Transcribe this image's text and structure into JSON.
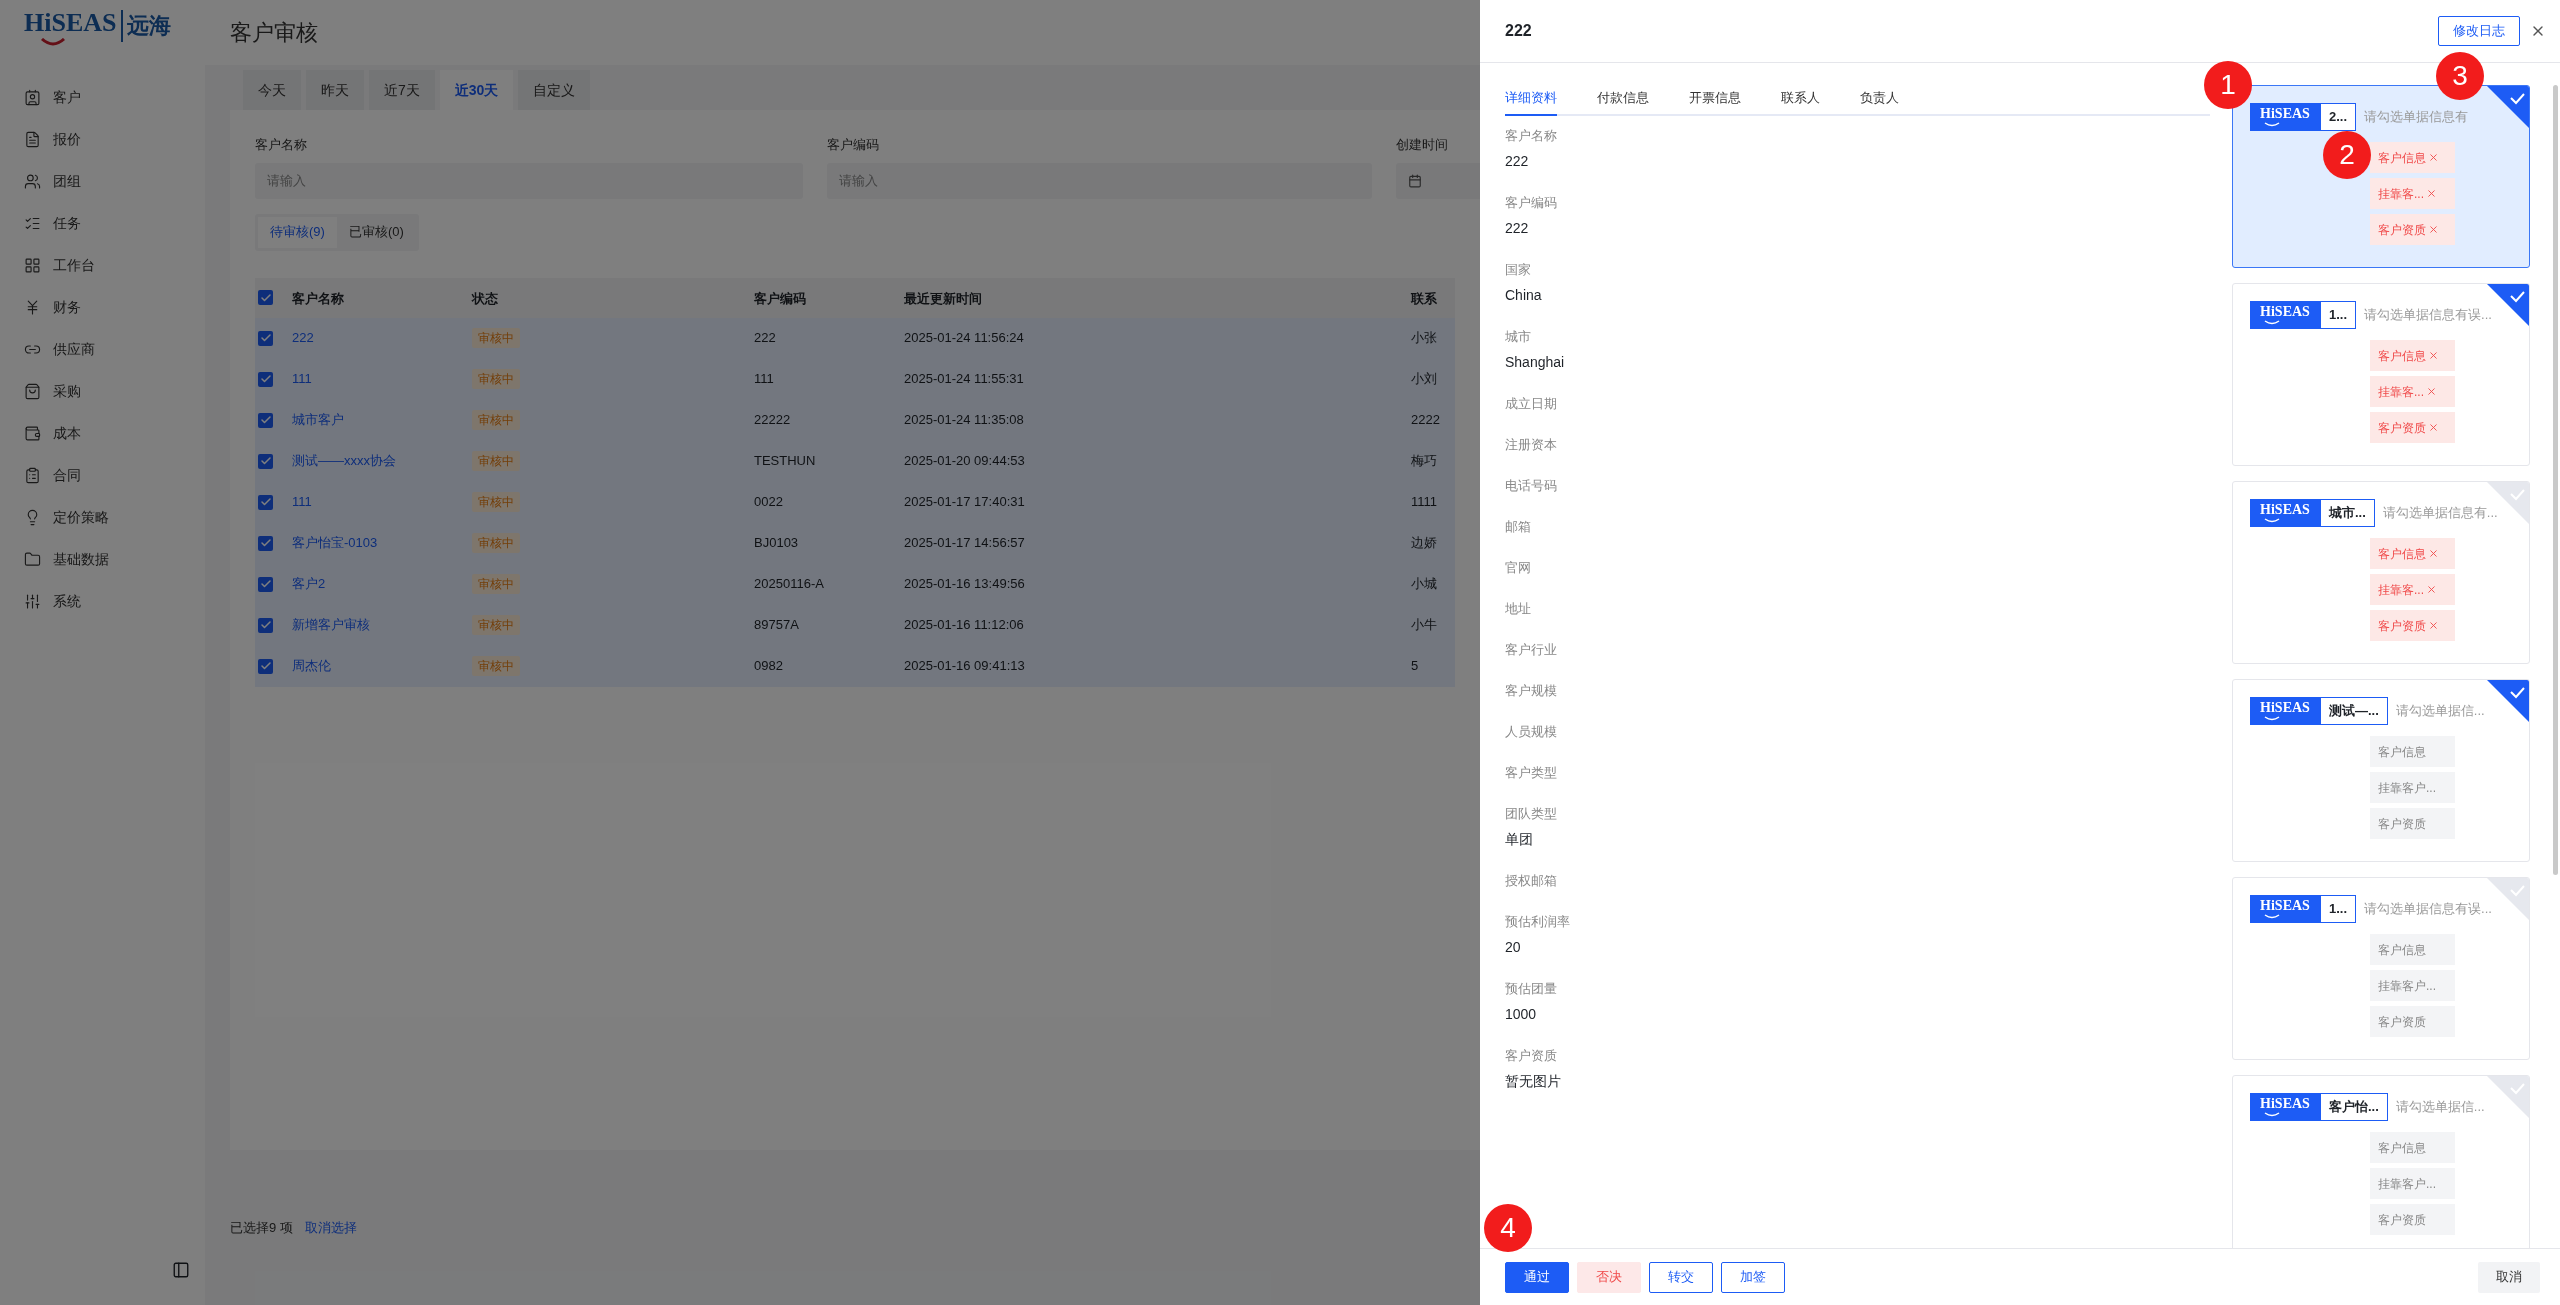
{
  "sidebar": {
    "logo": "HiSEAS",
    "logo_sub": "远海",
    "items": [
      {
        "label": "客户"
      },
      {
        "label": "报价"
      },
      {
        "label": "团组"
      },
      {
        "label": "任务"
      },
      {
        "label": "工作台"
      },
      {
        "label": "财务"
      },
      {
        "label": "供应商"
      },
      {
        "label": "采购"
      },
      {
        "label": "成本"
      },
      {
        "label": "合同"
      },
      {
        "label": "定价策略"
      },
      {
        "label": "基础数据"
      },
      {
        "label": "系统"
      }
    ]
  },
  "header": {
    "title": "客户审核"
  },
  "date_tabs": [
    {
      "label": "今天",
      "selected": false
    },
    {
      "label": "昨天",
      "selected": false
    },
    {
      "label": "近7天",
      "selected": false
    },
    {
      "label": "近30天",
      "selected": true
    },
    {
      "label": "自定义",
      "selected": false
    }
  ],
  "filters": [
    {
      "label": "客户名称",
      "kind": "text",
      "placeholder": "请输入"
    },
    {
      "label": "客户编码",
      "kind": "text",
      "placeholder": "请输入"
    },
    {
      "label": "创建时间",
      "kind": "date"
    }
  ],
  "status_tabs": [
    {
      "label": "待审核(9)",
      "selected": true
    },
    {
      "label": "已审核(0)",
      "selected": false
    }
  ],
  "table": {
    "all_checked": true,
    "columns": [
      "客户名称",
      "状态",
      "客户编码",
      "最近更新时间",
      "联系"
    ],
    "rows": [
      {
        "checked": true,
        "name": "222",
        "status": "审核中",
        "code": "222",
        "updated": "2025-01-24 11:56:24",
        "contact": "小张"
      },
      {
        "checked": true,
        "name": "111",
        "status": "审核中",
        "code": "111",
        "updated": "2025-01-24 11:55:31",
        "contact": "小刘"
      },
      {
        "checked": true,
        "name": "城市客户",
        "status": "审核中",
        "code": "22222",
        "updated": "2025-01-24 11:35:08",
        "contact": "2222"
      },
      {
        "checked": true,
        "name": "测试——xxxx协会",
        "status": "审核中",
        "code": "TESTHUN",
        "updated": "2025-01-20 09:44:53",
        "contact": "梅巧"
      },
      {
        "checked": true,
        "name": "111",
        "status": "审核中",
        "code": "0022",
        "updated": "2025-01-17 17:40:31",
        "contact": "1111"
      },
      {
        "checked": true,
        "name": "客户怡宝-0103",
        "status": "审核中",
        "code": "BJ0103",
        "updated": "2025-01-17 14:56:57",
        "contact": "边娇"
      },
      {
        "checked": true,
        "name": "客户2",
        "status": "审核中",
        "code": "20250116-A",
        "updated": "2025-01-16 13:49:56",
        "contact": "小城"
      },
      {
        "checked": true,
        "name": "新增客户审核",
        "status": "审核中",
        "code": "89757A",
        "updated": "2025-01-16 11:12:06",
        "contact": "小牛"
      },
      {
        "checked": true,
        "name": "周杰伦",
        "status": "审核中",
        "code": "0982",
        "updated": "2025-01-16 09:41:13",
        "contact": "5"
      }
    ]
  },
  "selection_bar": {
    "text": "已选择9 项",
    "clear": "取消选择"
  },
  "drawer": {
    "title": "222",
    "log_button": "修改日志",
    "tabs": [
      {
        "label": "详细资料",
        "selected": true
      },
      {
        "label": "付款信息",
        "selected": false
      },
      {
        "label": "开票信息",
        "selected": false
      },
      {
        "label": "联系人",
        "selected": false
      },
      {
        "label": "负责人",
        "selected": false
      }
    ],
    "fields": [
      {
        "label": "客户名称",
        "value": "222"
      },
      {
        "label": "客户编码",
        "value": "222"
      },
      {
        "label": "国家",
        "value": "China"
      },
      {
        "label": "城市",
        "value": "Shanghai"
      },
      {
        "label": "成立日期"
      },
      {
        "label": "注册资本"
      },
      {
        "label": "电话号码"
      },
      {
        "label": "邮箱"
      },
      {
        "label": "官网"
      },
      {
        "label": "地址"
      },
      {
        "label": "客户行业"
      },
      {
        "label": "客户规模"
      },
      {
        "label": "人员规模"
      },
      {
        "label": "客户类型"
      },
      {
        "label": "团队类型",
        "value": "单团"
      },
      {
        "label": "授权邮箱"
      },
      {
        "label": "预估利润率",
        "value": "20"
      },
      {
        "label": "预估团量",
        "value": "1000"
      },
      {
        "label": "客户资质",
        "value": "暂无图片"
      }
    ],
    "cards": [
      {
        "logo": "HiSEAS",
        "name": "2...",
        "hint": "请勾选单据信息有",
        "selected": true,
        "checked": true,
        "tags": [
          {
            "label": "客户信息",
            "selected": true
          },
          {
            "label": "挂靠客...",
            "selected": true
          },
          {
            "label": "客户资质",
            "selected": true
          }
        ]
      },
      {
        "logo": "HiSEAS",
        "name": "1...",
        "hint": "请勾选单据信息有误...",
        "selected": false,
        "checked": true,
        "tags": [
          {
            "label": "客户信息",
            "selected": true
          },
          {
            "label": "挂靠客...",
            "selected": true
          },
          {
            "label": "客户资质",
            "selected": true
          }
        ]
      },
      {
        "logo": "HiSEAS",
        "name": "城市...",
        "hint": "请勾选单据信息有...",
        "selected": false,
        "checked": false,
        "tags": [
          {
            "label": "客户信息",
            "selected": true
          },
          {
            "label": "挂靠客...",
            "selected": true
          },
          {
            "label": "客户资质",
            "selected": true
          }
        ]
      },
      {
        "logo": "HiSEAS",
        "name": "测试—...",
        "hint": "请勾选单据信...",
        "selected": false,
        "checked": true,
        "tags": [
          {
            "label": "客户信息",
            "selected": false
          },
          {
            "label": "挂靠客户...",
            "selected": false
          },
          {
            "label": "客户资质",
            "selected": false
          }
        ]
      },
      {
        "logo": "HiSEAS",
        "name": "1...",
        "hint": "请勾选单据信息有误...",
        "selected": false,
        "checked": false,
        "tags": [
          {
            "label": "客户信息",
            "selected": false
          },
          {
            "label": "挂靠客户...",
            "selected": false
          },
          {
            "label": "客户资质",
            "selected": false
          }
        ]
      },
      {
        "logo": "HiSEAS",
        "name": "客户怡...",
        "hint": "请勾选单据信...",
        "selected": false,
        "checked": false,
        "tags": [
          {
            "label": "客户信息",
            "selected": false
          },
          {
            "label": "挂靠客户...",
            "selected": false
          },
          {
            "label": "客户资质",
            "selected": false
          }
        ]
      }
    ],
    "actions": [
      {
        "label": "通过",
        "kind": "primary"
      },
      {
        "label": "否决",
        "kind": "danger"
      },
      {
        "label": "转交",
        "kind": "outline"
      },
      {
        "label": "加签",
        "kind": "outline"
      }
    ],
    "cancel": "取消"
  },
  "annotations": [
    "1",
    "2",
    "3",
    "4"
  ]
}
